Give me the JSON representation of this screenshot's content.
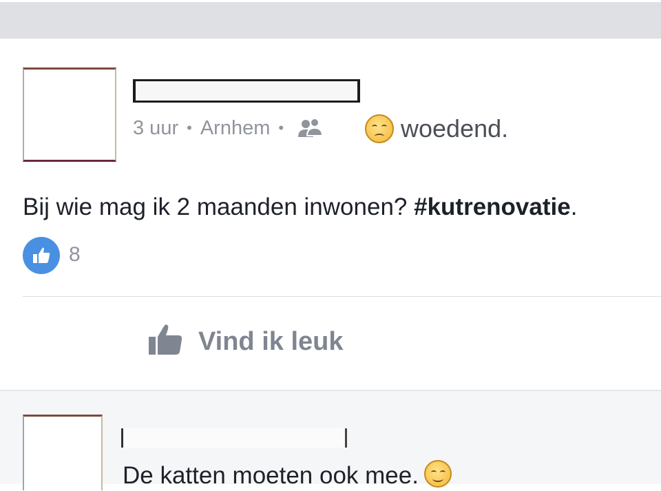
{
  "post": {
    "feeling": "woedend.",
    "time": "3 uur",
    "location": "Arnhem",
    "audience_icon": "friends-icon",
    "text_plain": "Bij wie mag ik 2 maanden inwonen? ",
    "hashtag": "#kutrenovatie",
    "text_end": ".",
    "like_count": "8",
    "feeling_emoji": "angry-face-emoji"
  },
  "actions": {
    "like_label": "Vind ik leuk"
  },
  "comment": {
    "text": "De katten moeten ook mee.",
    "emoji": "smiling-face-emoji"
  },
  "colors": {
    "like_blue": "#4a90e2",
    "secondary_text": "#90949c",
    "action_gray": "#7f8591"
  }
}
